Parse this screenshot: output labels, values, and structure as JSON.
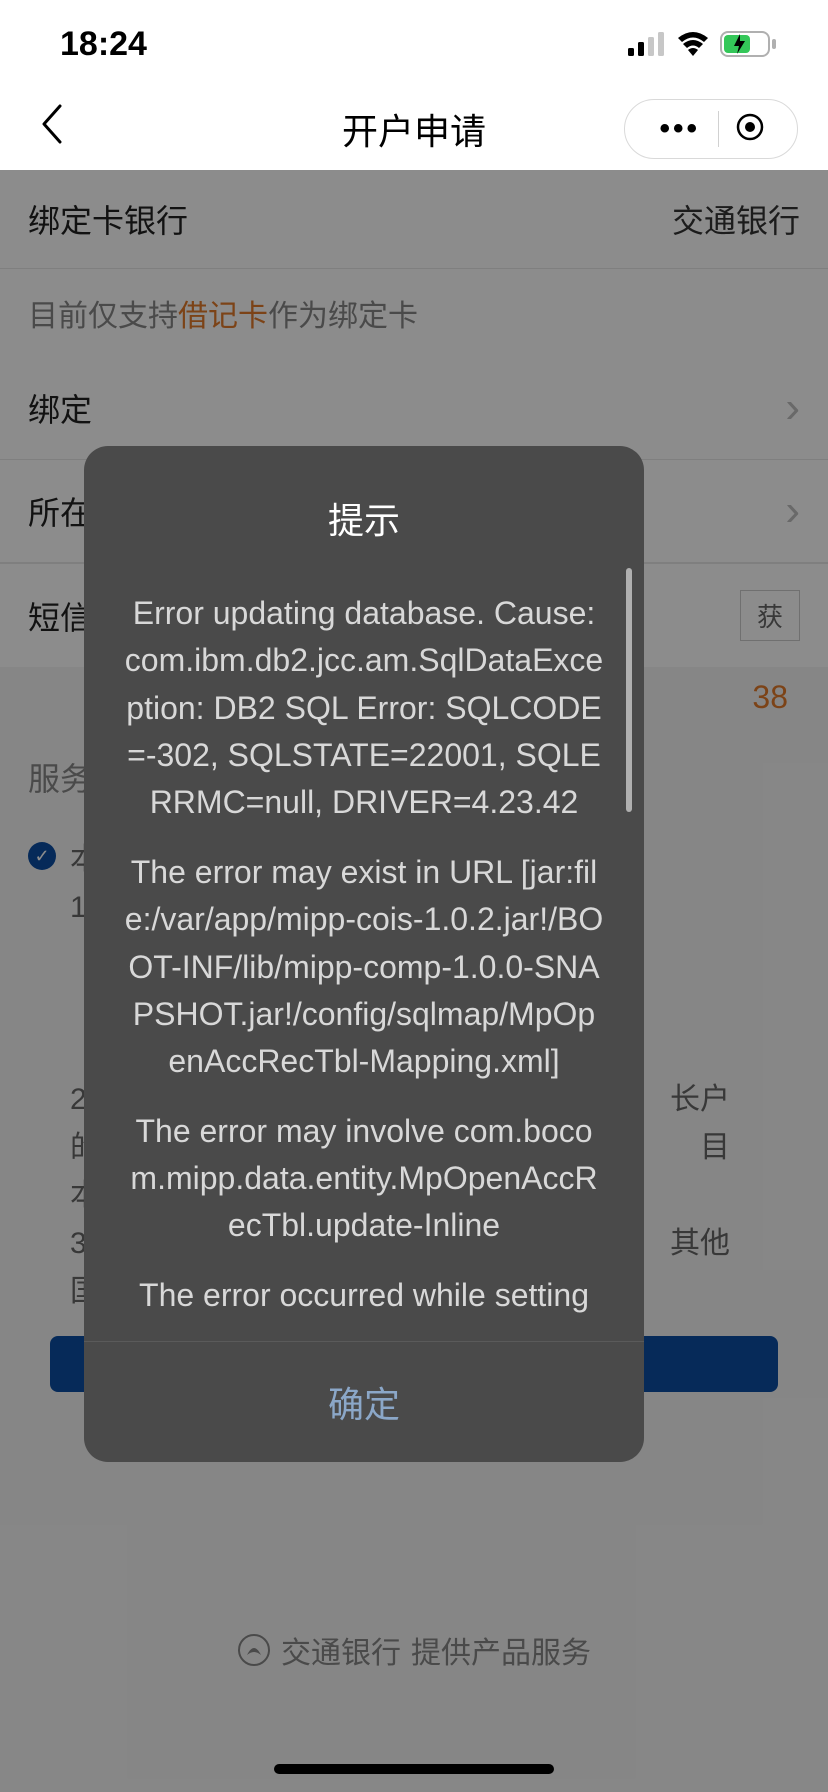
{
  "status": {
    "time": "18:24"
  },
  "nav": {
    "title": "开户申请"
  },
  "form": {
    "bank_label": "绑定卡银行",
    "bank_value": "交通银行",
    "hint_prefix": "目前仅支持",
    "hint_accent": "借记卡",
    "hint_suffix": "作为绑定卡",
    "bind_label": "绑定",
    "location_label": "所在",
    "sms_label": "短信",
    "sms_btn": "获",
    "sms_count": "38",
    "service_label": "服务",
    "submit": " "
  },
  "agreement": {
    "header": "本",
    "items": [
      "1.",
      "《",
      "《",
      "《",
      "2.",
      "的",
      "本",
      "3.",
      "国"
    ],
    "side1": "长户",
    "side2": "目",
    "side3": "其他"
  },
  "footer": {
    "brand": "交通银行",
    "text": "提供产品服务"
  },
  "modal": {
    "title": "提示",
    "p1": "Error updating database.  Cause: com.ibm.db2.jcc.am.SqlDataException: DB2 SQL Error: SQLCODE=-302, SQLSTATE=22001, SQLERRMC=null, DRIVER=4.23.42",
    "p2": "The error may exist in URL [jar:file:/var/app/mipp-cois-1.0.2.jar!/BOOT-INF/lib/mipp-comp-1.0.0-SNAPSHOT.jar!/config/sqlmap/MpOpenAccRecTbl-Mapping.xml]",
    "p3": "The error may involve com.bocom.mipp.data.entity.MpOpenAccRecTbl.update-Inline",
    "p4": "The error occurred while setting",
    "confirm": "确定"
  }
}
